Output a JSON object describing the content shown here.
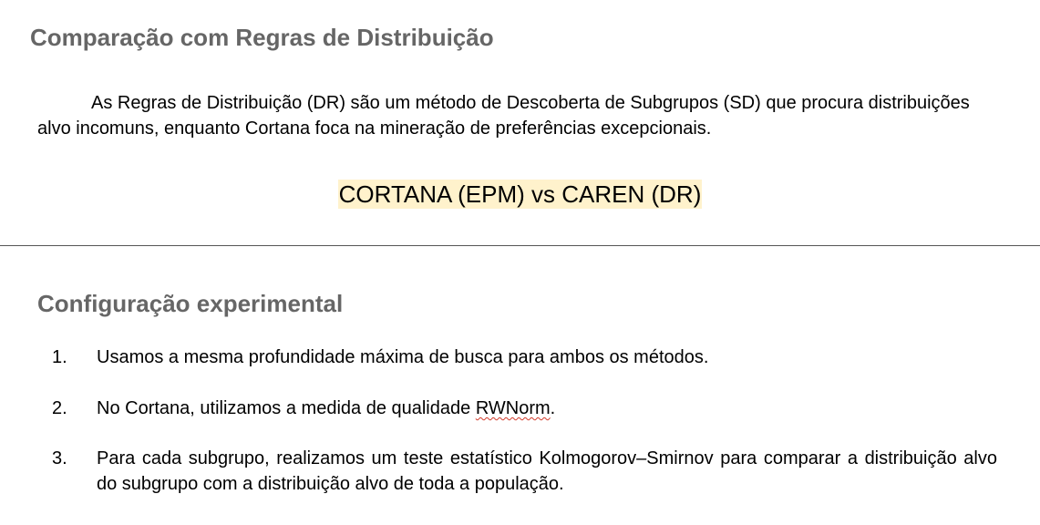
{
  "section1": {
    "title": "Comparação com Regras de Distribuição",
    "intro": "As Regras de Distribuição (DR) são um método de Descoberta de Subgrupos (SD) que procura distribuições alvo incomuns, enquanto Cortana foca na mineração de preferências excepcionais.",
    "comparison": "CORTANA (EPM) vs CAREN (DR)",
    "highlight_color": "#fff2cc"
  },
  "section2": {
    "title": "Configuração experimental",
    "items": [
      {
        "number": "1.",
        "text": "Usamos a mesma profundidade máxima de busca para ambos os métodos."
      },
      {
        "number": "2.",
        "text_before": "No Cortana, utilizamos a medida de qualidade ",
        "flagged_word": "RWNorm",
        "text_after": "."
      },
      {
        "number": "3.",
        "text": "Para cada subgrupo, realizamos um teste estatístico Kolmogorov–Smirnov para comparar a distribuição alvo do subgrupo com a distribuição alvo de toda a população."
      }
    ]
  },
  "colors": {
    "heading": "#666666",
    "body": "#000000",
    "spellcheck": "#d23a2a"
  }
}
